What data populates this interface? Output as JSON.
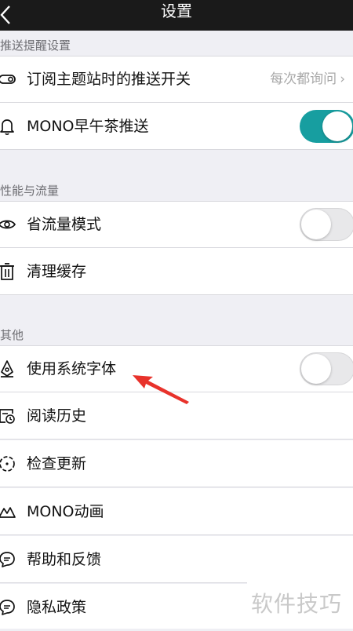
{
  "header": {
    "title": "设置",
    "back_icon": "chevron-left-icon"
  },
  "sections": [
    {
      "title": "推送提醒设置",
      "items": [
        {
          "label": "订阅主题站时的推送开关",
          "icon": "toggle-icon",
          "value": "每次都询问",
          "chevron": "›"
        },
        {
          "label": "MONO早午茶推送",
          "icon": "bell-icon",
          "toggle": "on"
        }
      ]
    },
    {
      "title": "性能与流量",
      "items": [
        {
          "label": "省流量模式",
          "icon": "eye-icon",
          "toggle": "off"
        },
        {
          "label": "清理缓存",
          "icon": "trash-icon"
        }
      ]
    },
    {
      "title": "其他",
      "items": [
        {
          "label": "使用系统字体",
          "icon": "pen-nib-icon",
          "toggle": "off"
        },
        {
          "label": "阅读历史",
          "icon": "history-icon"
        },
        {
          "label": "检查更新",
          "icon": "refresh-icon"
        },
        {
          "label": "MONO动画",
          "icon": "mountain-icon"
        },
        {
          "label": "帮助和反馈",
          "icon": "chat-icon"
        },
        {
          "label": "隐私政策",
          "icon": "chat-icon"
        }
      ]
    }
  ],
  "annotation": {
    "color": "#e8322b"
  },
  "watermark": {
    "text": "软件技巧"
  },
  "colors": {
    "toggle_on": "#179ea0",
    "header_bg": "#1a1a1a",
    "background": "#efeff4"
  }
}
